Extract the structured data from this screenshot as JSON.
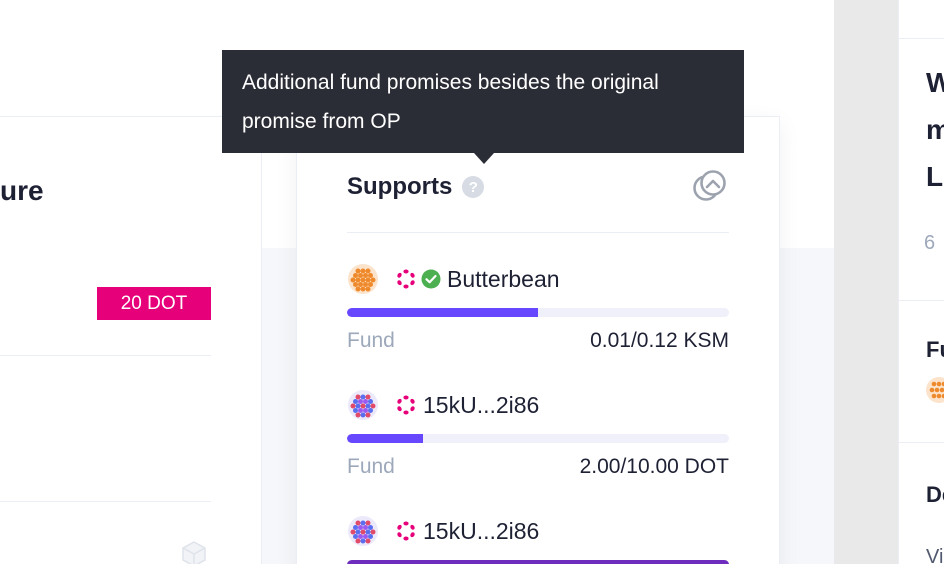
{
  "left_card": {
    "title_fragment": "ure",
    "badge": "20 DOT"
  },
  "tooltip": {
    "line1": "Additional fund promises besides the original",
    "line2": "promise from OP"
  },
  "supports": {
    "title": "Supports",
    "help_icon": "?",
    "entries": [
      {
        "name": "Butterbean",
        "verified": true,
        "fund_label": "Fund",
        "amount": "0.01/0.12 KSM",
        "progress": 0.5
      },
      {
        "name": "15kU...2i86",
        "verified": false,
        "fund_label": "Fund",
        "amount": "2.00/10.00 DOT",
        "progress": 0.2
      },
      {
        "name": "15kU...2i86",
        "verified": false,
        "fund_label": "Fund",
        "amount": "",
        "progress": 1.0
      }
    ]
  },
  "right_card": {
    "title_line1": "W",
    "title_line2": "m",
    "title_line3": "La",
    "count": "6",
    "section1": "Fu",
    "section2": "De",
    "body_text": "Vi"
  },
  "colors": {
    "accent": "#6848ff",
    "brand_pink": "#e6007a",
    "success": "#4caf50",
    "tooltip_bg": "#2b2d36"
  }
}
